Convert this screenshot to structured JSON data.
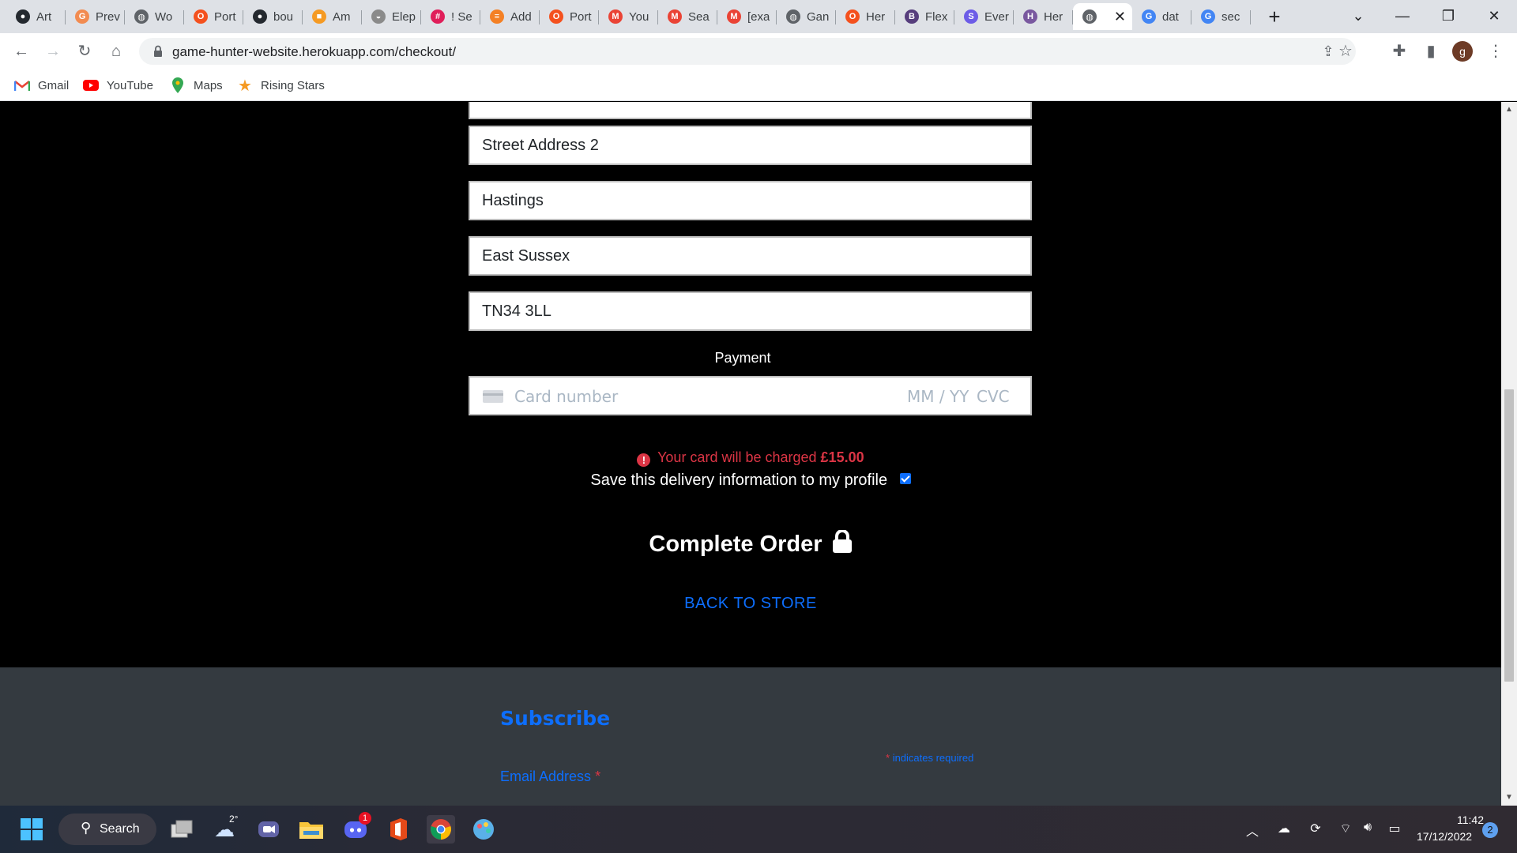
{
  "browser": {
    "tabs": [
      {
        "title": "Art",
        "icon": "github-icon",
        "color": "#24292f"
      },
      {
        "title": "Prev",
        "icon": "refresh-ext-icon",
        "color": "#f28b50"
      },
      {
        "title": "Wo",
        "icon": "globe-icon",
        "color": "#5f6368"
      },
      {
        "title": "Port",
        "icon": "opera-icon",
        "color": "#f4511e"
      },
      {
        "title": "bou",
        "icon": "github-icon",
        "color": "#24292f"
      },
      {
        "title": "Am",
        "icon": "box-icon",
        "color": "#f59a23"
      },
      {
        "title": "Elep",
        "icon": "elephant-icon",
        "color": "#8a8a8a"
      },
      {
        "title": "! Se",
        "icon": "slack-icon",
        "color": "#e01e5a"
      },
      {
        "title": "Add",
        "icon": "stackoverflow-icon",
        "color": "#f48024"
      },
      {
        "title": "Port",
        "icon": "opera-icon",
        "color": "#f4511e"
      },
      {
        "title": "You",
        "icon": "gmail-icon",
        "color": "#ea4335"
      },
      {
        "title": "Sea",
        "icon": "gmail-icon",
        "color": "#ea4335"
      },
      {
        "title": "[exa",
        "icon": "gmail-icon",
        "color": "#ea4335"
      },
      {
        "title": "Gan",
        "icon": "globe-icon",
        "color": "#5f6368"
      },
      {
        "title": "Her",
        "icon": "opera-icon",
        "color": "#f4511e"
      },
      {
        "title": "Flex",
        "icon": "bootstrap-icon",
        "color": "#563d7c"
      },
      {
        "title": "Ever",
        "icon": "s-icon",
        "color": "#6c5ce7"
      },
      {
        "title": "Her",
        "icon": "heroku-icon",
        "color": "#79589f"
      },
      {
        "title": "",
        "icon": "globe-icon",
        "color": "#5f6368",
        "active": true
      },
      {
        "title": "dat",
        "icon": "google-icon",
        "color": "#4285f4"
      },
      {
        "title": "sec",
        "icon": "google-icon",
        "color": "#4285f4"
      }
    ],
    "url": "game-hunter-website.herokuapp.com/checkout/",
    "profile_initial": "g",
    "bookmarks": [
      {
        "label": "Gmail",
        "icon": "gmail-icon"
      },
      {
        "label": "YouTube",
        "icon": "youtube-icon"
      },
      {
        "label": "Maps",
        "icon": "maps-icon"
      },
      {
        "label": "Rising Stars",
        "icon": "star-icon"
      }
    ]
  },
  "checkout": {
    "fields": [
      {
        "name": "street-address-2-field",
        "value": "Street Address 2"
      },
      {
        "name": "town-city-field",
        "value": "Hastings"
      },
      {
        "name": "county-field",
        "value": "East Sussex"
      },
      {
        "name": "postcode-field",
        "value": "TN34 3LL"
      }
    ],
    "payment_label": "Payment",
    "card": {
      "number_placeholder": "Card number",
      "expiry_placeholder": "MM / YY",
      "cvc_placeholder": "CVC"
    },
    "charge_prefix": "Your card will be charged",
    "charge_amount": "£15.00",
    "save_label": "Save this delivery information to my profile",
    "save_checked": true,
    "complete_label": "Complete Order",
    "back_label": "Back to store"
  },
  "footer": {
    "subscribe_title": "Subscribe",
    "required_asterisk": "*",
    "required_note": "indicates required",
    "email_label": "Email Address",
    "email_asterisk": "*"
  },
  "taskbar": {
    "search_label": "Search",
    "weather_temp": "2°",
    "discord_badge": "1",
    "time": "11:42",
    "date": "17/12/2022",
    "notification_count": "2"
  },
  "colors": {
    "accent": "#0d6efd",
    "danger": "#dc3545",
    "footer_bg": "#343a40",
    "page_bg": "#000000"
  }
}
